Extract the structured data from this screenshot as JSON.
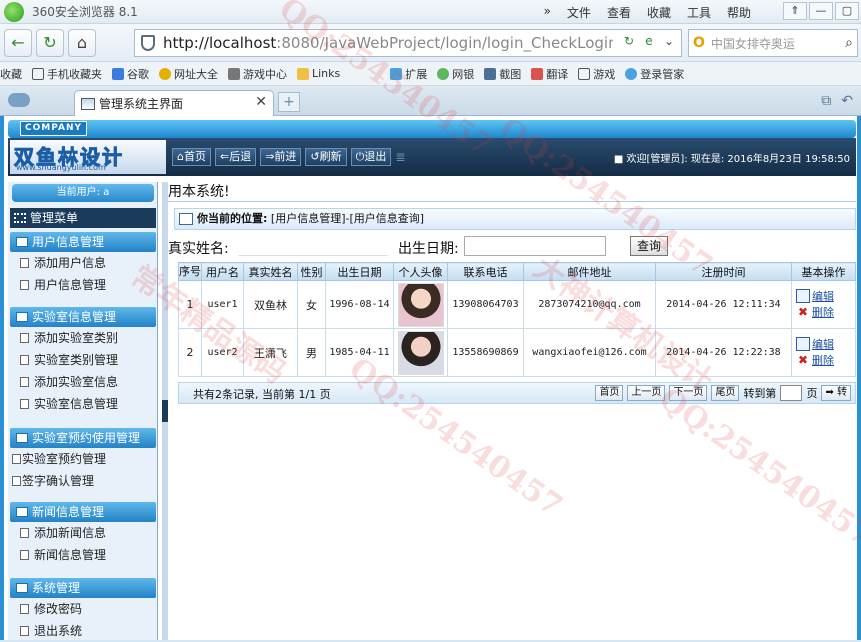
{
  "browser": {
    "app_title": "360安全浏览器 8.1",
    "menu": [
      "»",
      "文件",
      "查看",
      "收藏",
      "工具",
      "帮助"
    ],
    "window_buttons": [
      "⇑",
      "—",
      "▢"
    ],
    "url_host": "http://localhost",
    "url_rest": ":8080/JavaWebProject/login/login_CheckLogin.act",
    "search_placeholder": "中国女排夺奥运",
    "bookmarks": [
      "收藏",
      "手机收藏夹",
      "谷歌",
      "网址大全",
      "游戏中心",
      "Links",
      "扩展",
      "网银",
      "截图",
      "翻译",
      "游戏",
      "登录管家"
    ],
    "tab_label": "管理系统主界面"
  },
  "header": {
    "company": "COMPANY",
    "logo_text": "双鱼林设计",
    "logo_url": "www.shuangyulin.com",
    "buttons": [
      "首页",
      "后退",
      "前进",
      "刷新",
      "退出"
    ],
    "welcome": "■ 欢迎[管理员]:  现在是: 2016年8月23日  19:58:50"
  },
  "sidebar": {
    "current_user": "当前用户: a",
    "menu_title": "管理菜单",
    "groups": [
      {
        "title": "用户信息管理",
        "items": [
          "添加用户信息",
          "用户信息管理"
        ]
      },
      {
        "title": "实验室信息管理",
        "items": [
          "添加实验室类别",
          "实验室类别管理",
          "添加实验室信息",
          "实验室信息管理"
        ]
      },
      {
        "title": "实验室预约使用管理",
        "items": [
          "实验室预约管理",
          "签字确认管理"
        ]
      },
      {
        "title": "新闻信息管理",
        "items": [
          "添加新闻信息",
          "新闻信息管理"
        ]
      },
      {
        "title": "系统管理",
        "items": [
          "修改密码",
          "退出系统"
        ]
      }
    ]
  },
  "content": {
    "marquee": "用本系统!",
    "position_label": "你当前的位置:",
    "position_path": "[用户信息管理]-[用户信息查询]",
    "search_name_label": "真实姓名:",
    "search_birth_label": "出生日期:",
    "search_button": "查询",
    "columns": [
      "序号",
      "用户名",
      "真实姓名",
      "性别",
      "出生日期",
      "个人头像",
      "联系电话",
      "邮件地址",
      "注册时间",
      "基本操作"
    ],
    "rows": [
      {
        "no": "1",
        "username": "user1",
        "realname": "双鱼林",
        "sex": "女",
        "birth": "1996-08-14",
        "phone": "13908064703",
        "email": "2873074210@qq.com",
        "regtime": "2014-04-26 12:11:34"
      },
      {
        "no": "2",
        "username": "user2",
        "realname": "王潇飞",
        "sex": "男",
        "birth": "1985-04-11",
        "phone": "13558690869",
        "email": "wangxiaofei@126.com",
        "regtime": "2014-04-26 12:22:38"
      }
    ],
    "edit_label": "编辑",
    "delete_label": "删除",
    "pager_info": "共有2条记录, 当前第 1/1 页",
    "pager_buttons": [
      "首页",
      "上一页",
      "下一页",
      "尾页"
    ],
    "goto_label": "转到第",
    "page_unit": "页",
    "go_button": "➡ 转"
  },
  "watermarks": [
    "QQ:254540457",
    "大神计算机设计",
    "常年精品源码"
  ]
}
